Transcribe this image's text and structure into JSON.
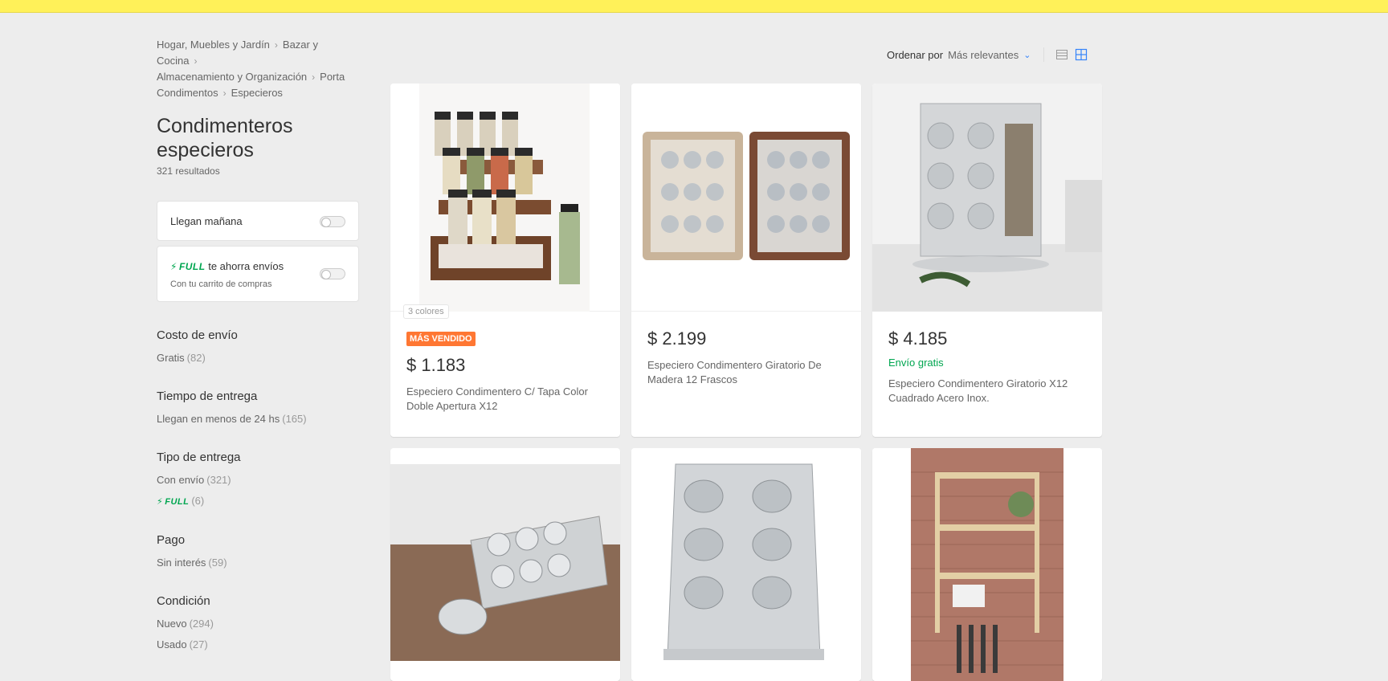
{
  "breadcrumb": [
    "Hogar, Muebles y Jardín",
    "Bazar y Cocina",
    "Almacenamiento y Organización",
    "Porta Condimentos",
    "Especieros"
  ],
  "page": {
    "title": "Condimenteros especieros",
    "results": "321 resultados"
  },
  "toggles": {
    "tomorrow": "Llegan mañana",
    "full_brand": "FULL",
    "full_text": "te ahorra envíos",
    "full_sub": "Con tu carrito de compras"
  },
  "filters": [
    {
      "title": "Costo de envío",
      "options": [
        {
          "label": "Gratis",
          "count": "(82)"
        }
      ]
    },
    {
      "title": "Tiempo de entrega",
      "options": [
        {
          "label": "Llegan en menos de 24 hs",
          "count": "(165)"
        }
      ]
    },
    {
      "title": "Tipo de entrega",
      "options": [
        {
          "label": "Con envío",
          "count": "(321)"
        },
        {
          "label": "FULL",
          "count": "(6)"
        }
      ]
    },
    {
      "title": "Pago",
      "options": [
        {
          "label": "Sin interés",
          "count": "(59)"
        }
      ]
    },
    {
      "title": "Condición",
      "options": [
        {
          "label": "Nuevo",
          "count": "(294)"
        },
        {
          "label": "Usado",
          "count": "(27)"
        }
      ]
    }
  ],
  "sort": {
    "label": "Ordenar por",
    "value": "Más relevantes"
  },
  "products": [
    {
      "colors": "3 colores",
      "badge": "MÁS VENDIDO",
      "price": "$ 1.183",
      "shipping": "",
      "title": "Especiero Condimentero C/ Tapa Color Doble Apertura X12"
    },
    {
      "colors": "",
      "badge": "",
      "price": "$ 2.199",
      "shipping": "",
      "title": "Especiero Condimentero Giratorio De Madera 12 Frascos"
    },
    {
      "colors": "",
      "badge": "",
      "price": "$ 4.185",
      "shipping": "Envío gratis",
      "title": "Especiero Condimentero Giratorio X12 Cuadrado Acero Inox."
    }
  ],
  "colors": {
    "accent": "#3483fa",
    "green": "#00a650",
    "badge": "#ff7733",
    "topbar": "#fff159"
  }
}
